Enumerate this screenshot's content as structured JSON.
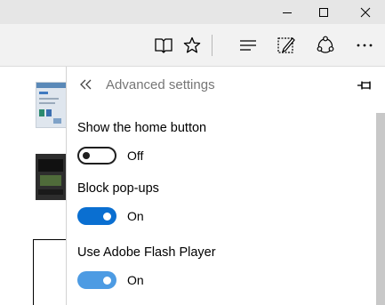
{
  "window": {
    "controls": [
      {
        "name": "minimize-icon"
      },
      {
        "name": "maximize-icon"
      },
      {
        "name": "close-icon"
      }
    ]
  },
  "toolbar": {
    "icons": [
      "reading-view-icon",
      "favorite-star-icon",
      "hub-icon",
      "web-note-icon",
      "share-icon",
      "more-icon"
    ]
  },
  "panel": {
    "title": "Advanced settings",
    "settings": [
      {
        "label": "Show the home button",
        "state": "Off",
        "on": false
      },
      {
        "label": "Block pop-ups",
        "state": "On",
        "on": true
      },
      {
        "label": "Use Adobe Flash Player",
        "state": "On",
        "on": true
      }
    ]
  },
  "colors": {
    "accent": "#0a6fd1",
    "accent_light": "#4d9be3",
    "titlebar": "#e6e6e6",
    "toolbar": "#f2f2f2"
  }
}
